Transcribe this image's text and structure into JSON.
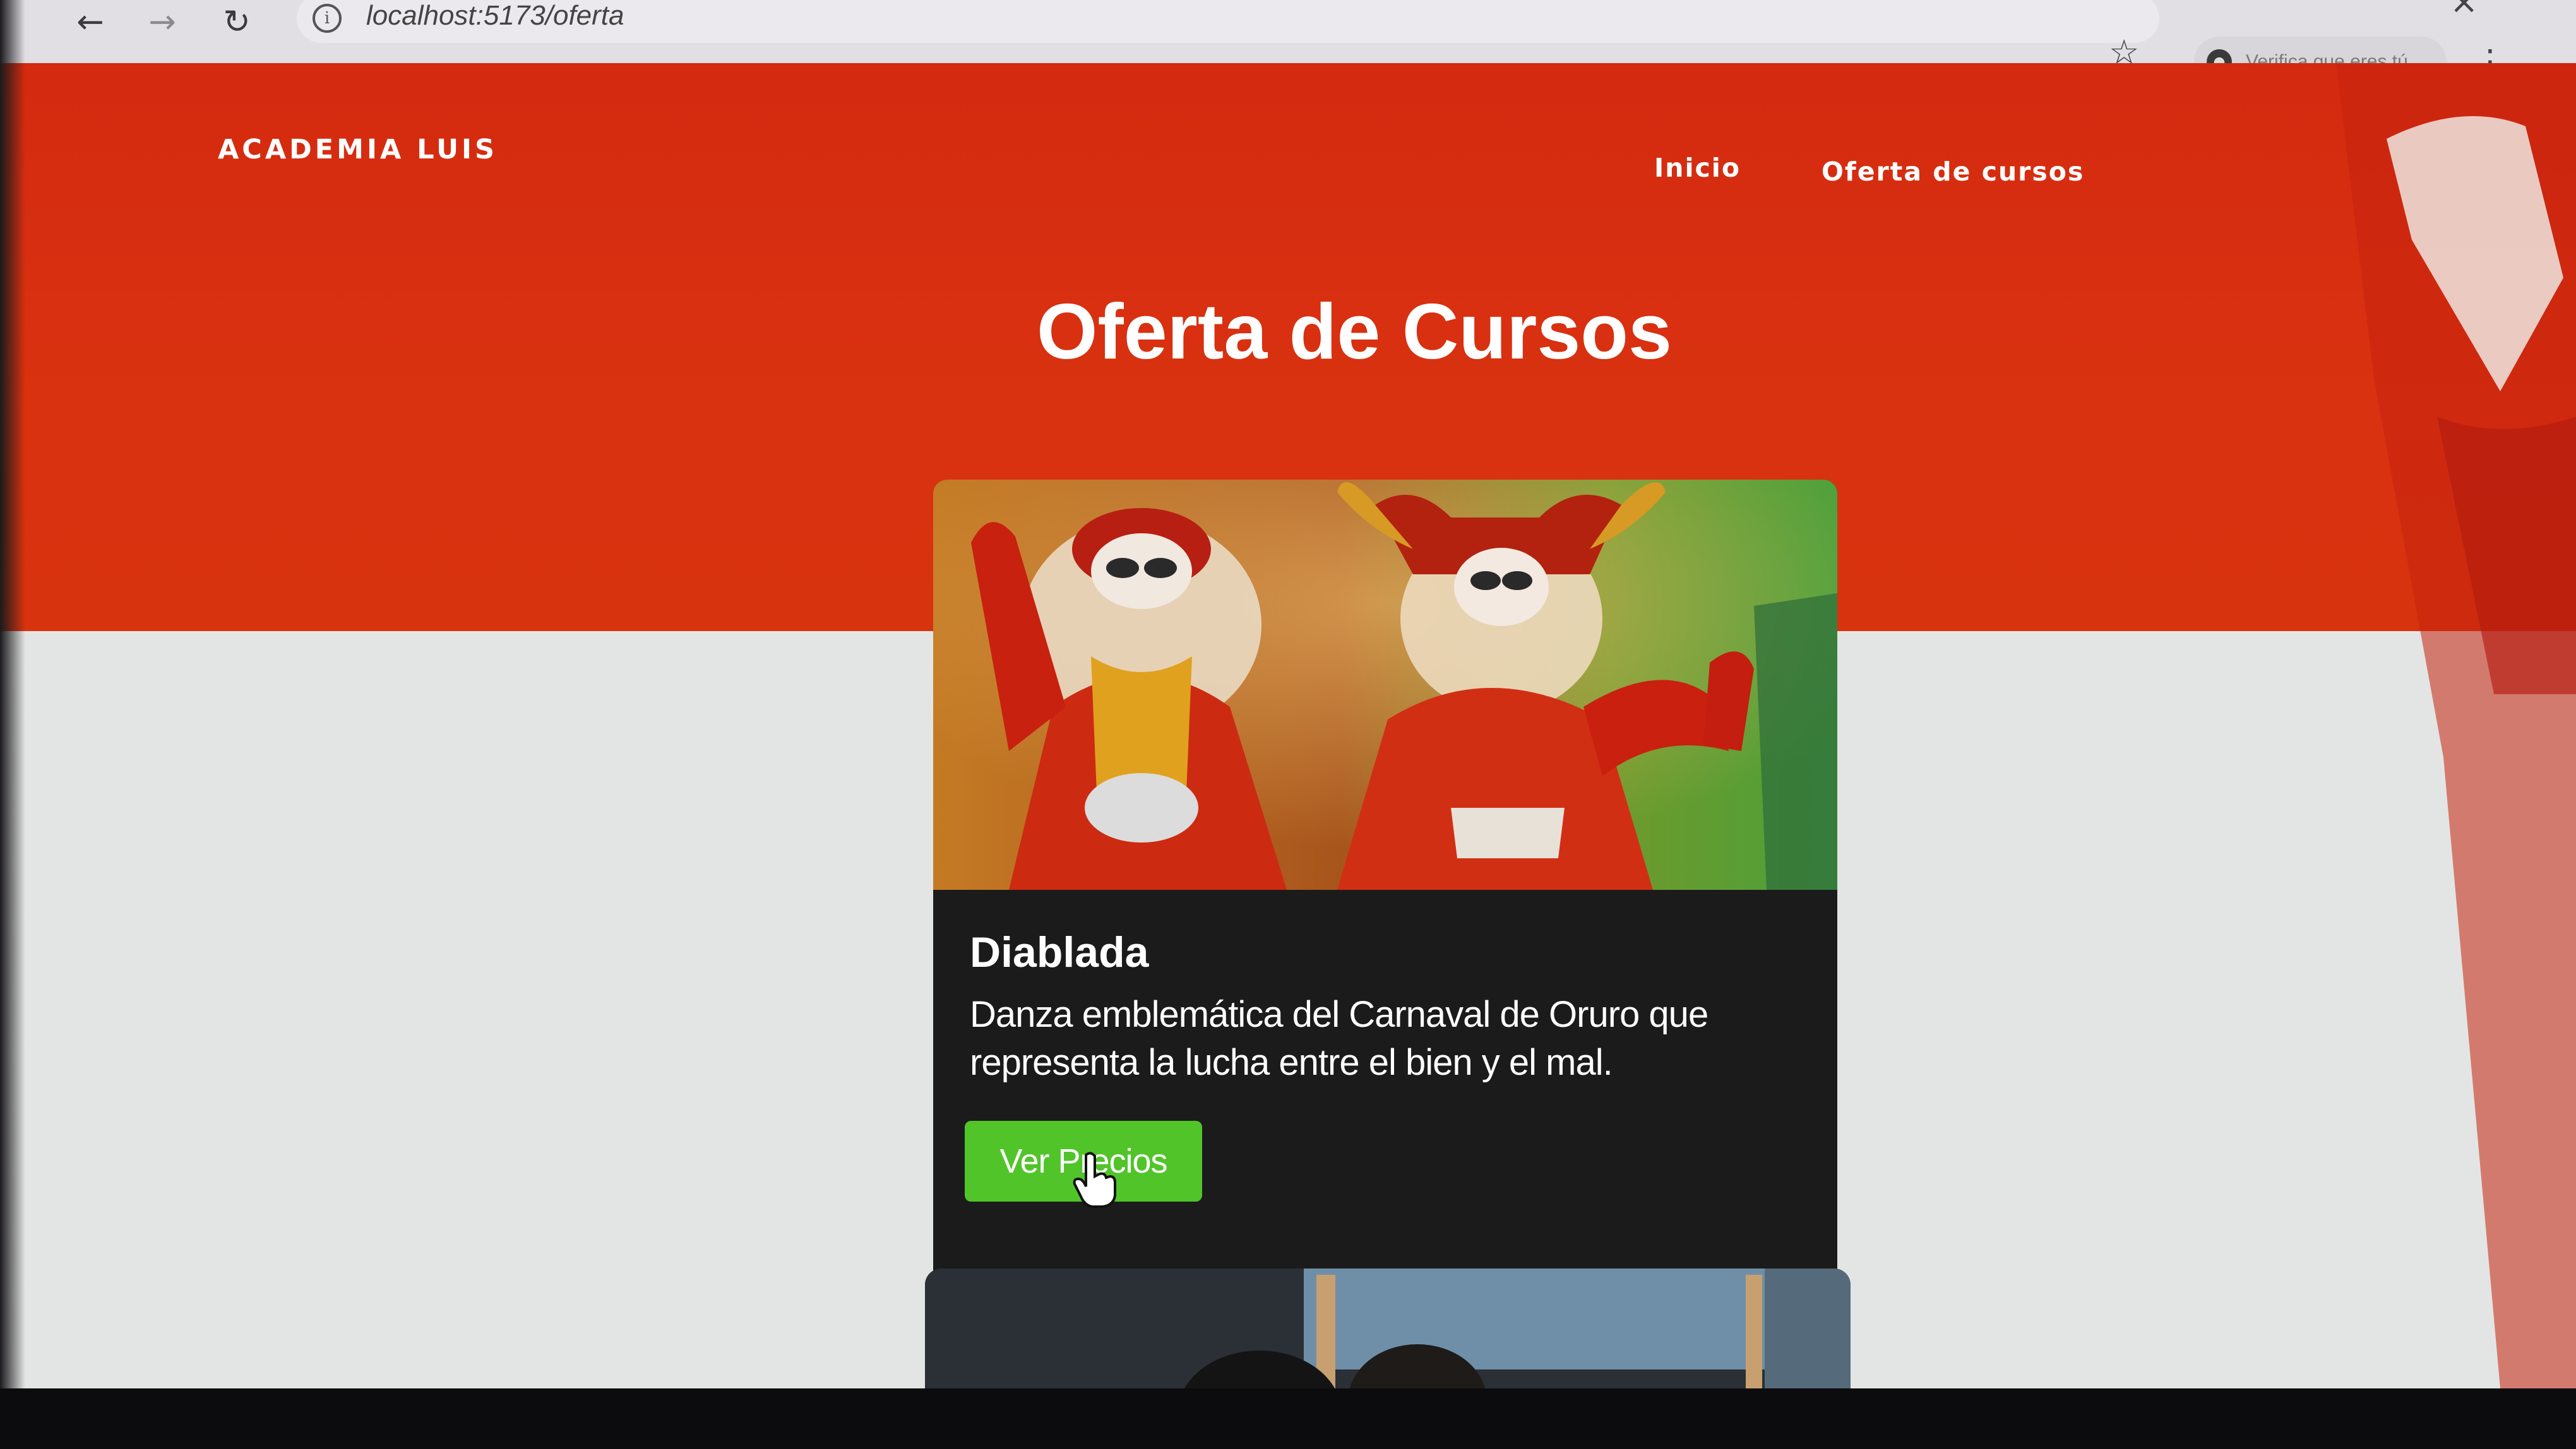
{
  "browser": {
    "url": "localhost:5173/oferta",
    "profile_label": "Verifica que eres tú",
    "icons": {
      "back": "arrow-left-icon",
      "forward": "arrow-right-icon",
      "reload": "reload-icon",
      "site_info": "info-icon",
      "bookmark": "star-icon",
      "menu": "kebab-menu-icon"
    }
  },
  "header": {
    "brand": "ACADEMIA LUIS",
    "nav": [
      {
        "label": "Inicio"
      },
      {
        "label": "Oferta de cursos"
      }
    ]
  },
  "hero": {
    "title": "Oferta de Cursos"
  },
  "courses": [
    {
      "title": "Diablada",
      "description": "Danza emblemática del Carnaval de Oruro que representa la lucha entre el bien y el mal.",
      "button_label": "Ver Precios"
    }
  ],
  "colors": {
    "hero_red": "#d42a10",
    "card_bg": "#1b1b1c",
    "button_green": "#51c42a",
    "page_bg": "#e3e5e4"
  }
}
